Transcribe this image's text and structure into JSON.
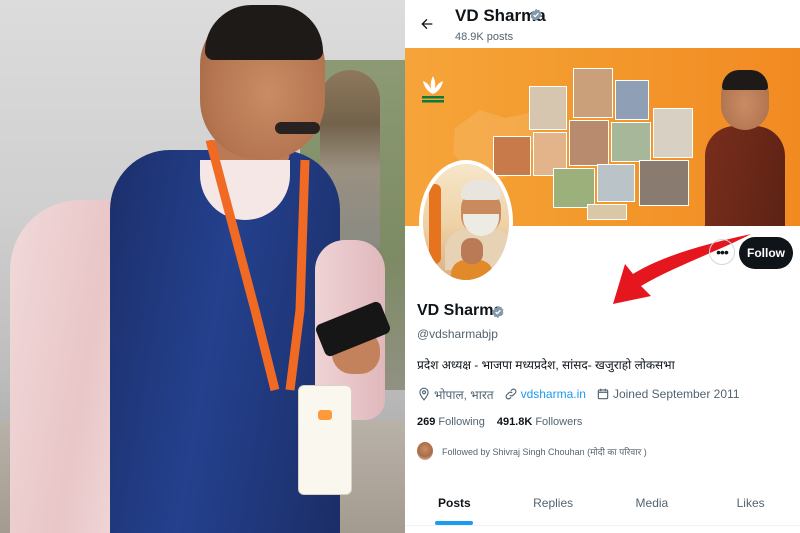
{
  "topbar": {
    "name": "VD Sharma",
    "posts_count": "48.9K posts"
  },
  "icons": {
    "back": "arrow-left-icon",
    "verified": "verified-badge-icon",
    "location": "location-pin-icon",
    "link": "link-icon",
    "calendar": "calendar-icon",
    "more": "more-horizontal-icon"
  },
  "profile": {
    "name": "VD Sharma",
    "handle": "@vdsharmabjp",
    "bio": "प्रदेश अध्यक्ष - भाजपा मध्यप्रदेश, सांसद- खजुराहो लोकसभा",
    "location": "भोपाल, भारत",
    "website": "vdsharma.in",
    "joined": "Joined September 2011",
    "following_count": "269",
    "following_label": "Following",
    "followers_count": "491.8K",
    "followers_label": "Followers",
    "followed_by": "Followed by Shivraj Singh Chouhan (मोदी का परिवार )"
  },
  "actions": {
    "more_label": "•••",
    "follow_label": "Follow"
  },
  "tabs": [
    {
      "label": "Posts",
      "active": true
    },
    {
      "label": "Replies",
      "active": false
    },
    {
      "label": "Media",
      "active": false
    },
    {
      "label": "Likes",
      "active": false
    }
  ],
  "colors": {
    "accent": "#1d9bf0",
    "banner": "#f39b2e",
    "follow_button": "#0f1419",
    "arrow": "#e5161d"
  }
}
